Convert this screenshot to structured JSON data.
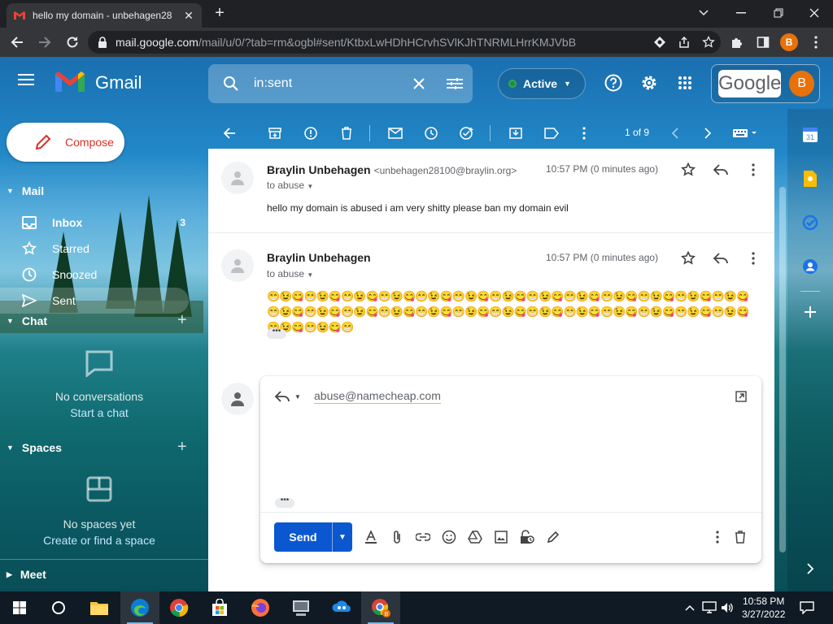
{
  "browser": {
    "tab_title": "hello my domain - unbehagen28",
    "url_host": "mail.google.com",
    "url_path": "/mail/u/0/?tab=rm&ogbl#sent/KtbxLwHDhHCrvhSVlKJhTNRMLHrrKMJVbB",
    "profile_initial": "B"
  },
  "gmail": {
    "product_name": "Gmail",
    "search_value": "in:sent",
    "status_label": "Active",
    "google_word": "Google",
    "avatar_initial": "B",
    "compose_label": "Compose",
    "mail_section": "Mail",
    "nav": [
      {
        "label": "Inbox",
        "count": "3",
        "icon": "inbox-icon"
      },
      {
        "label": "Starred",
        "count": "",
        "icon": "star-icon"
      },
      {
        "label": "Snoozed",
        "count": "",
        "icon": "clock-icon"
      },
      {
        "label": "Sent",
        "count": "",
        "icon": "send-icon"
      }
    ],
    "chat_section": "Chat",
    "chat_empty": "No conversations",
    "chat_link": "Start a chat",
    "spaces_section": "Spaces",
    "spaces_empty": "No spaces yet",
    "spaces_link": "Create or find a space",
    "meet_section": "Meet",
    "page_count": "1 of 9"
  },
  "thread": {
    "messages": [
      {
        "sender": "Braylin Unbehagen",
        "email": "<unbehagen28100@braylin.org>",
        "time": "10:57 PM (0 minutes ago)",
        "to": "to abuse",
        "body": "hello my domain is abused i am very shitty please ban my domain evil"
      },
      {
        "sender": "Braylin Unbehagen",
        "time": "10:57 PM (0 minutes ago)",
        "to": "to abuse",
        "body": "😁😉😋😁😉😋😁😉😋😁😉😋😁😉😋😁😉😋😁😉😋😁😉😋😁😉😋😁😉😋😁😉😋😁😉😋😁😉😋😁😉😋😁😉😋😁😉😋😁😉😋😁😉😋😁😉😋😁😉😋😁😉😋😁😉😋😁😉😋😁😉😋😁😉😋😁😉😋😁😉😋😁😉😋😁"
      }
    ],
    "ellipsis": "•••"
  },
  "reply": {
    "recipient": "abuse@namecheap.com",
    "send_label": "Send",
    "ellipsis": "•••"
  },
  "taskbar": {
    "time": "10:58 PM",
    "date": "3/27/2022"
  },
  "colors": {
    "gmail_blue": "#1a73e8",
    "send_button": "#0b57d0",
    "compose_text": "#d93025",
    "avatar_orange": "#e8710a",
    "active_green": "#1e8e3e"
  }
}
